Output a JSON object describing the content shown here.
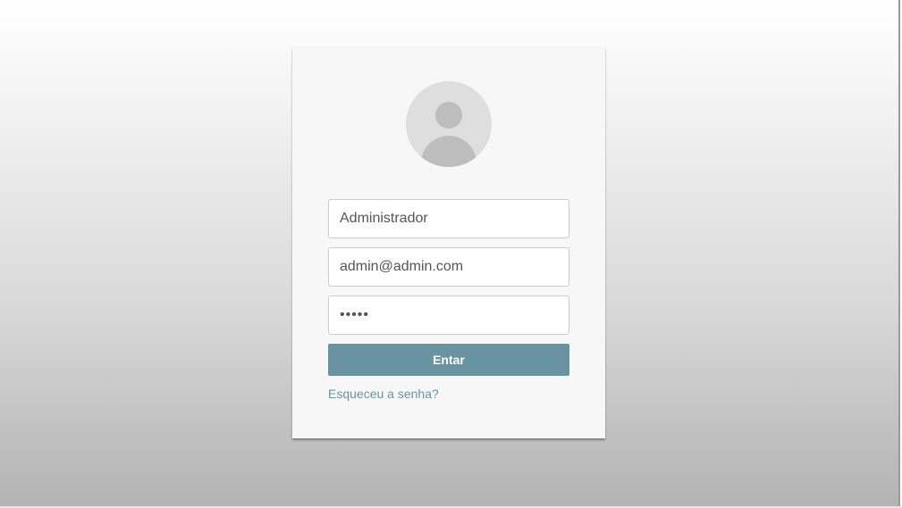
{
  "login": {
    "name_value": "Administrador",
    "email_value": "admin@admin.com",
    "password_value": "senha",
    "submit_label": "Entar",
    "forgot_label": "Esqueceu a senha?"
  },
  "icons": {
    "avatar": "user-avatar-icon"
  },
  "colors": {
    "accent": "#6a93a2",
    "card_background": "#f7f7f7",
    "avatar_background": "#dedede",
    "avatar_figure": "#bdbdbd"
  }
}
